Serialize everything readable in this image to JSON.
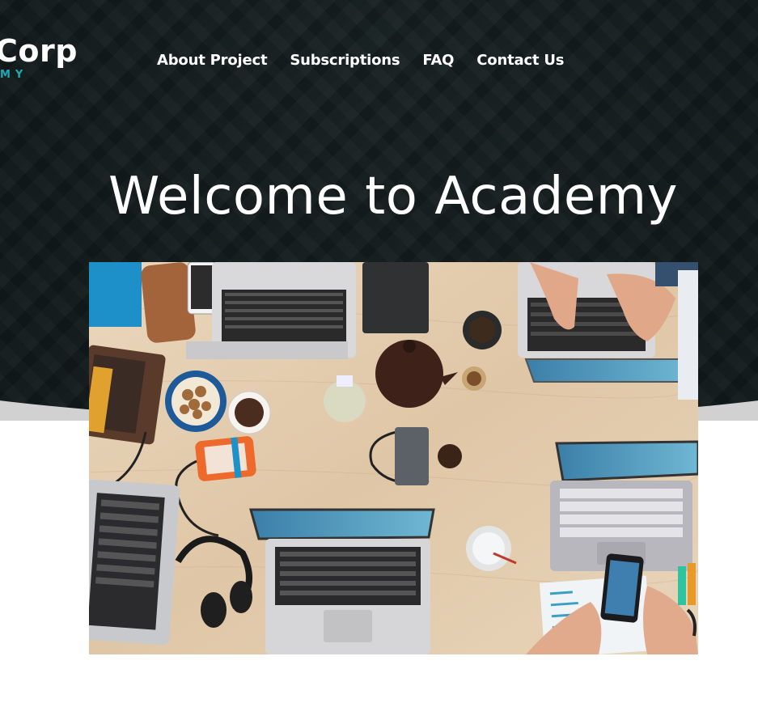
{
  "brand": {
    "logo_word": "Corp",
    "logo_sub": "MY",
    "accent_color": "#1ca9b8"
  },
  "nav": {
    "items": [
      "About Project",
      "Subscriptions",
      "FAQ",
      "Contact Us"
    ]
  },
  "hero": {
    "title": "Welcome to Academy",
    "background_color": "#162021",
    "image": "overhead photo of desk with laptops"
  }
}
